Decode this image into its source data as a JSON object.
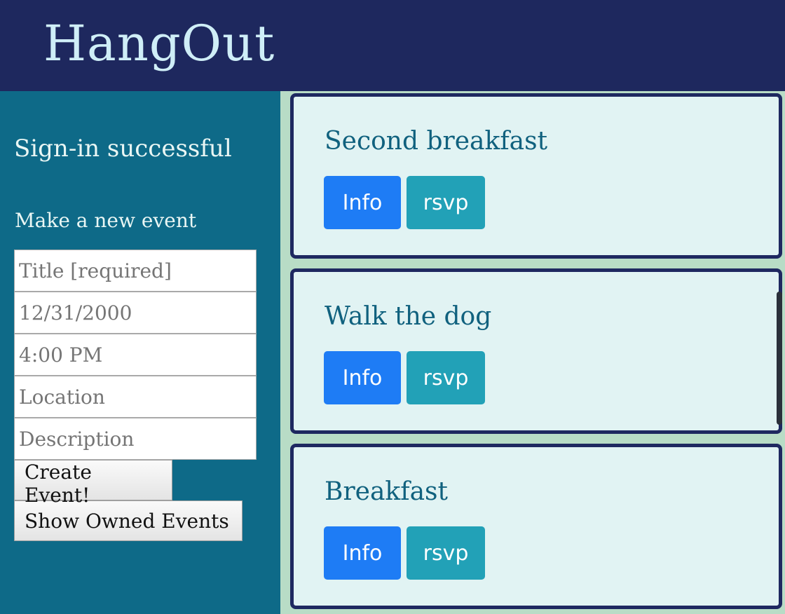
{
  "header": {
    "title": "HangOut"
  },
  "sidebar": {
    "status": "Sign-in successful",
    "form_heading": "Make a new event",
    "fields": {
      "title": {
        "value": "",
        "placeholder": "Title [required]"
      },
      "date": {
        "value": "",
        "placeholder": "12/31/2000"
      },
      "time": {
        "value": "",
        "placeholder": "4:00 PM"
      },
      "location": {
        "value": "",
        "placeholder": "Location"
      },
      "description": {
        "value": "",
        "placeholder": "Description"
      }
    },
    "create_button": "Create Event!",
    "show_owned_button": "Show Owned Events"
  },
  "events": [
    {
      "title": "Second breakfast",
      "info_label": "Info",
      "rsvp_label": "rsvp"
    },
    {
      "title": "Walk the dog",
      "info_label": "Info",
      "rsvp_label": "rsvp"
    },
    {
      "title": "Breakfast",
      "info_label": "Info",
      "rsvp_label": "rsvp"
    }
  ],
  "colors": {
    "header_bg": "#1e285e",
    "sidebar_bg": "#0e6a88",
    "card_bg": "#e1f3f3",
    "card_border": "#1e2860",
    "info_button": "#1e7cf5",
    "rsvp_button": "#22a1b7"
  }
}
